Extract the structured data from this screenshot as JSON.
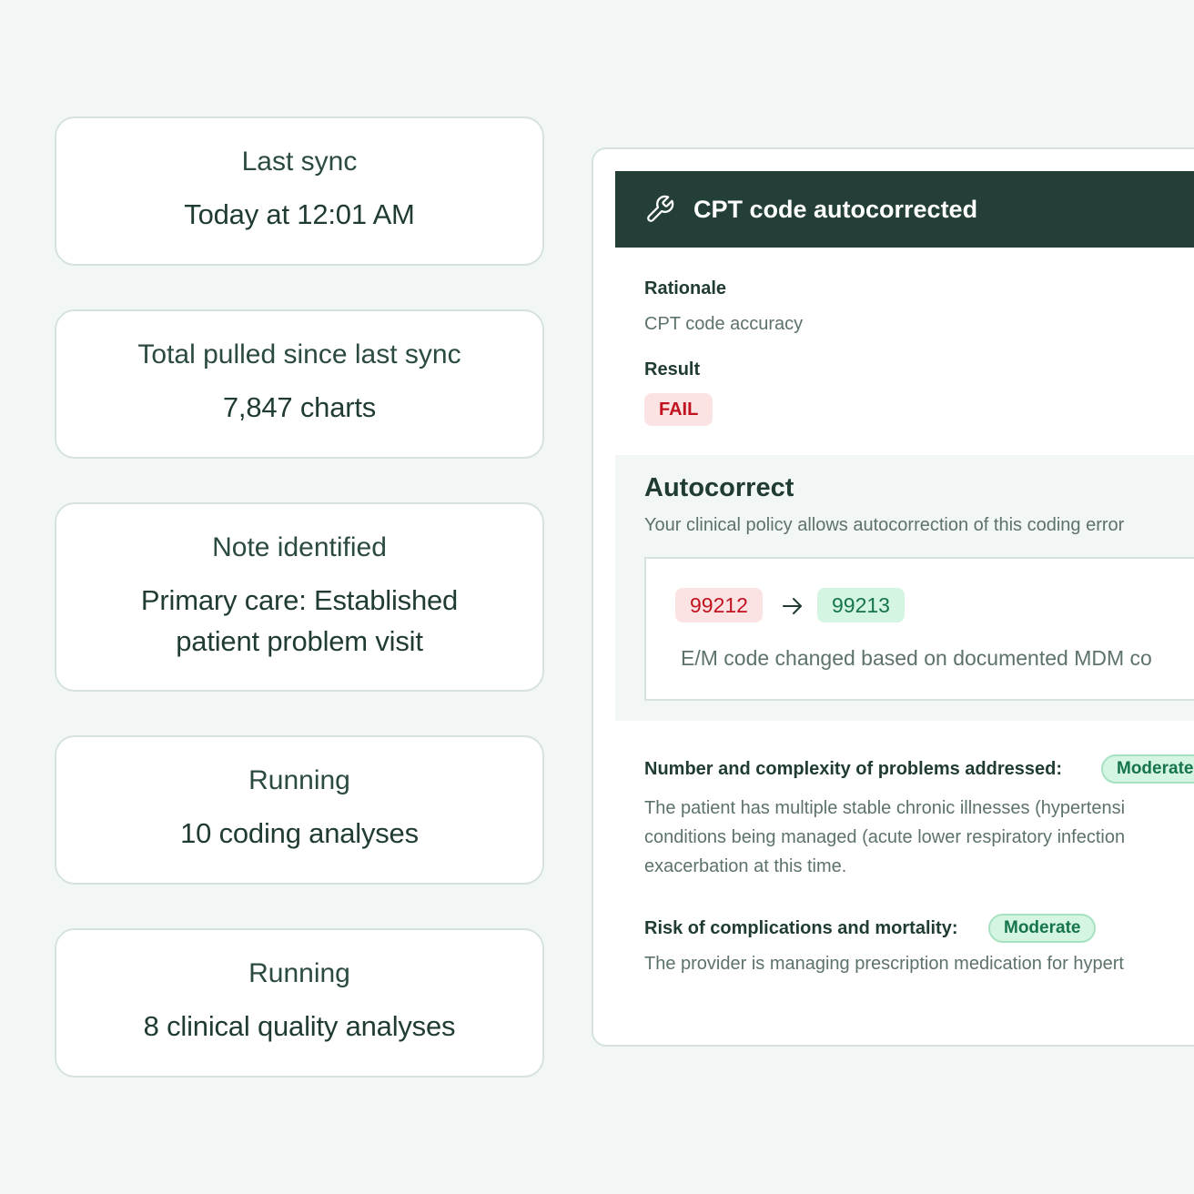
{
  "status_cards": [
    {
      "label": "Last sync",
      "lines": [
        "Today at 12:01 AM"
      ]
    },
    {
      "label": "Total pulled since last sync",
      "lines": [
        "7,847 charts"
      ]
    },
    {
      "label": "Note identified",
      "lines": [
        "Primary care: Established",
        "patient problem visit"
      ]
    },
    {
      "label": "Running",
      "lines": [
        "10 coding analyses"
      ]
    },
    {
      "label": "Running",
      "lines": [
        "8 clinical quality analyses"
      ]
    }
  ],
  "panel": {
    "header_icon": "wrench-icon",
    "title": "CPT code autocorrected",
    "rationale_label": "Rationale",
    "rationale_value": "CPT code accuracy",
    "result_label": "Result",
    "result_value": "FAIL",
    "autocorrect": {
      "title": "Autocorrect",
      "description": "Your clinical policy allows autocorrection of this coding error",
      "old_code": "99212",
      "new_code": "99213",
      "arrow_icon": "arrow-right-icon",
      "note": "E/M code changed based on documented MDM co"
    },
    "mdm_items": [
      {
        "title": "Number and complexity of problems addressed:",
        "level": "Moderate",
        "text_lines": [
          "The patient has multiple stable chronic illnesses (hypertensi",
          "conditions being managed (acute lower respiratory infection",
          "exacerbation at this time."
        ]
      },
      {
        "title": "Risk of complications and mortality:",
        "level": "Moderate",
        "text_lines": [
          "The provider is managing prescription medication for hypert"
        ]
      }
    ]
  },
  "colors": {
    "background": "#f2f6f4",
    "header": "#233f38",
    "fail_red": "#c1121f",
    "success_green": "#16744a"
  }
}
